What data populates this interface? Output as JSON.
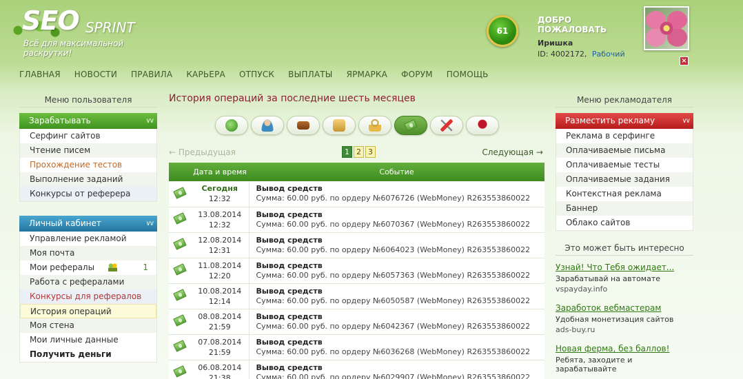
{
  "logo": {
    "seo": "SEO",
    "sprint": "SPRINT",
    "tagline": "Всё для максимальной раскрутки!"
  },
  "user": {
    "level": "61",
    "welcome": "ДОБРО ПОЖАЛОВАТЬ",
    "name": "Иришка",
    "id_text": "ID: 4002172,",
    "status": "Рабочий"
  },
  "close_label": "×",
  "nav": [
    "ГЛАВНАЯ",
    "НОВОСТИ",
    "ПРАВИЛА",
    "КАРЬЕРА",
    "ОТПУСК",
    "ВЫПЛАТЫ",
    "ЯРМАРКА",
    "ФОРУМ",
    "ПОМОЩЬ"
  ],
  "left": {
    "title": "Меню пользователя",
    "earn": {
      "header": "Зарабатывать",
      "items": [
        "Серфинг сайтов",
        "Чтение писем",
        "Прохождение тестов",
        "Выполнение заданий",
        "Конкурсы от реферера"
      ]
    },
    "cabinet": {
      "header": "Личный кабинет",
      "items": [
        "Управление рекламой",
        "Моя почта",
        "Мои рефералы",
        "Работа с рефералами",
        "Конкурсы для рефералов",
        "История операций",
        "Моя стена",
        "Мои личные данные",
        "Получить деньги"
      ],
      "referrals_count": "1"
    }
  },
  "main": {
    "title": "История операций за последние шесть месяцев",
    "pager": {
      "prev": "← Предыдущая",
      "next": "Следующая →",
      "pages": [
        "1",
        "2",
        "3"
      ]
    },
    "table": {
      "headers": [
        "Дата и время",
        "Событие"
      ],
      "rows": [
        {
          "date": "Сегодня",
          "time": "12:32",
          "title": "Вывод средств",
          "desc": "Сумма: 60.00 руб. по ордеру №6076726 (WebMoney) R263553860022"
        },
        {
          "date": "13.08.2014",
          "time": "12:32",
          "title": "Вывод средств",
          "desc": "Сумма: 60.00 руб. по ордеру №6070367 (WebMoney) R263553860022"
        },
        {
          "date": "12.08.2014",
          "time": "12:31",
          "title": "Вывод средств",
          "desc": "Сумма: 60.00 руб. по ордеру №6064023 (WebMoney) R263553860022"
        },
        {
          "date": "11.08.2014",
          "time": "12:20",
          "title": "Вывод средств",
          "desc": "Сумма: 60.00 руб. по ордеру №6057363 (WebMoney) R263553860022"
        },
        {
          "date": "10.08.2014",
          "time": "12:14",
          "title": "Вывод средств",
          "desc": "Сумма: 60.00 руб. по ордеру №6050587 (WebMoney) R263553860022"
        },
        {
          "date": "08.08.2014",
          "time": "21:59",
          "title": "Вывод средств",
          "desc": "Сумма: 60.00 руб. по ордеру №6042367 (WebMoney) R263553860022"
        },
        {
          "date": "07.08.2014",
          "time": "21:59",
          "title": "Вывод средств",
          "desc": "Сумма: 60.00 руб. по ордеру №6036268 (WebMoney) R263553860022"
        },
        {
          "date": "06.08.2014",
          "time": "21:38",
          "title": "Вывод средств",
          "desc": "Сумма: 60.00 руб. по ордеру №6029907 (WebMoney) R263553860022"
        }
      ]
    }
  },
  "right": {
    "title": "Меню рекламодателя",
    "advert": {
      "header": "Разместить рекламу",
      "items": [
        "Реклама в серфинге",
        "Оплачиваемые письма",
        "Оплачиваемые тесты",
        "Оплачиваемые задания",
        "Контекстная реклама",
        "Баннер",
        "Облако сайтов"
      ]
    },
    "interest": {
      "title": "Это может быть интересно",
      "items": [
        {
          "link": "Узнай! Что Тебя ожидает...",
          "desc": "Зарабатывай на автомате",
          "site": "vspayday.info"
        },
        {
          "link": "Заработок вебмастерам",
          "desc": "Удобная монетизация сайтов",
          "site": "ads-buy.ru"
        },
        {
          "link": "Новая ферма, без баллов!",
          "desc": "Ребята, заходите и зарабатывайте",
          "site": ""
        }
      ]
    }
  }
}
